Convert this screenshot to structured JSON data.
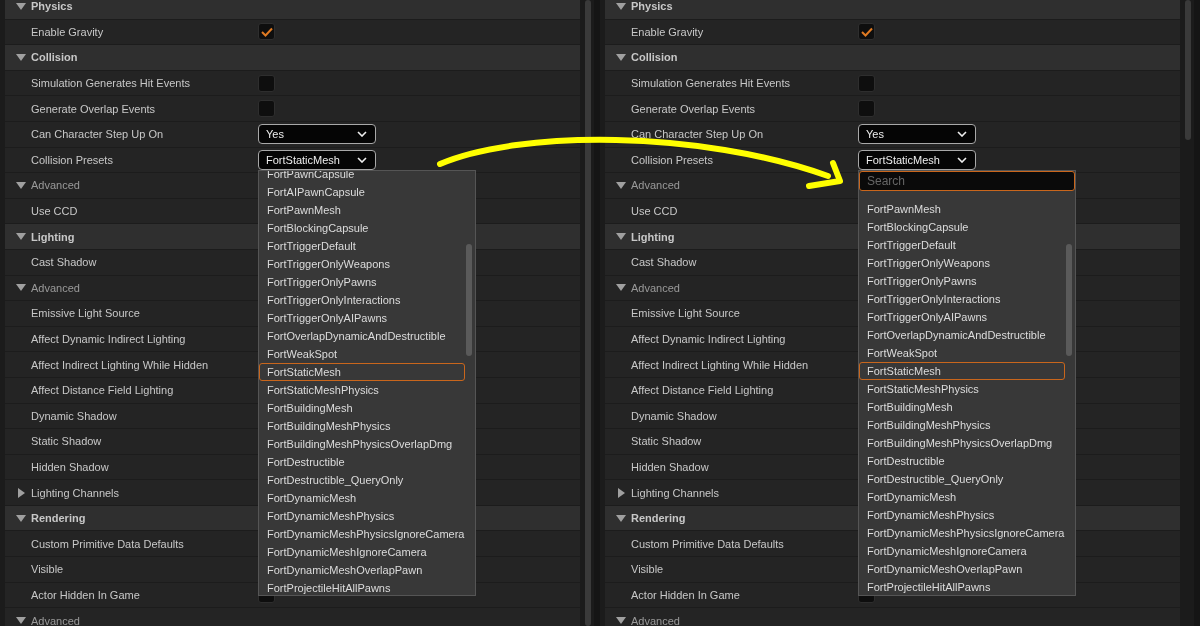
{
  "panels": [
    {
      "rows": [
        {
          "kind": "section",
          "label": "Physics",
          "expanded": true
        },
        {
          "kind": "checkbox",
          "label": "Enable Gravity",
          "checked": true
        },
        {
          "kind": "section",
          "label": "Collision",
          "expanded": true
        },
        {
          "kind": "checkbox",
          "label": "Simulation Generates Hit Events",
          "checked": false
        },
        {
          "kind": "checkbox",
          "label": "Generate Overlap Events",
          "checked": false
        },
        {
          "kind": "combo",
          "label": "Can Character Step Up On",
          "value": "Yes"
        },
        {
          "kind": "combo",
          "label": "Collision Presets",
          "value": "FortStaticMesh",
          "open": true
        },
        {
          "kind": "subsection",
          "label": "Advanced",
          "expanded": true
        },
        {
          "kind": "plain",
          "label": "Use CCD"
        },
        {
          "kind": "section",
          "label": "Lighting",
          "expanded": true
        },
        {
          "kind": "plain",
          "label": "Cast Shadow"
        },
        {
          "kind": "subsection",
          "label": "Advanced",
          "expanded": true
        },
        {
          "kind": "plain",
          "label": "Emissive Light Source"
        },
        {
          "kind": "plain",
          "label": "Affect Dynamic Indirect Lighting"
        },
        {
          "kind": "plain",
          "label": "Affect Indirect Lighting While Hidden"
        },
        {
          "kind": "plain",
          "label": "Affect Distance Field Lighting"
        },
        {
          "kind": "plain",
          "label": "Dynamic Shadow"
        },
        {
          "kind": "plain",
          "label": "Static Shadow"
        },
        {
          "kind": "plain",
          "label": "Hidden Shadow"
        },
        {
          "kind": "group",
          "label": "Lighting Channels",
          "expanded": false
        },
        {
          "kind": "section",
          "label": "Rendering",
          "expanded": true
        },
        {
          "kind": "plain",
          "label": "Custom Primitive Data Defaults"
        },
        {
          "kind": "plain",
          "label": "Visible"
        },
        {
          "kind": "checkbox",
          "label": "Actor Hidden In Game",
          "checked": false
        },
        {
          "kind": "subsection",
          "label": "Advanced",
          "expanded": true
        }
      ],
      "dropdown": {
        "items": [
          {
            "label": "FortPawnCapsule",
            "selected": false
          },
          {
            "label": "FortAIPawnCapsule",
            "selected": false
          },
          {
            "label": "FortPawnMesh",
            "selected": false
          },
          {
            "label": "FortBlockingCapsule",
            "selected": false
          },
          {
            "label": "FortTriggerDefault",
            "selected": false
          },
          {
            "label": "FortTriggerOnlyWeapons",
            "selected": false
          },
          {
            "label": "FortTriggerOnlyPawns",
            "selected": false
          },
          {
            "label": "FortTriggerOnlyInteractions",
            "selected": false
          },
          {
            "label": "FortTriggerOnlyAIPawns",
            "selected": false
          },
          {
            "label": "FortOverlapDynamicAndDestructible",
            "selected": false
          },
          {
            "label": "FortWeakSpot",
            "selected": false
          },
          {
            "label": "FortStaticMesh",
            "selected": true
          },
          {
            "label": "FortStaticMeshPhysics",
            "selected": false
          },
          {
            "label": "FortBuildingMesh",
            "selected": false
          },
          {
            "label": "FortBuildingMeshPhysics",
            "selected": false
          },
          {
            "label": "FortBuildingMeshPhysicsOverlapDmg",
            "selected": false
          },
          {
            "label": "FortDestructible",
            "selected": false
          },
          {
            "label": "FortDestructible_QueryOnly",
            "selected": false
          },
          {
            "label": "FortDynamicMesh",
            "selected": false
          },
          {
            "label": "FortDynamicMeshPhysics",
            "selected": false
          },
          {
            "label": "FortDynamicMeshPhysicsIgnoreCamera",
            "selected": false
          },
          {
            "label": "FortDynamicMeshIgnoreCamera",
            "selected": false
          },
          {
            "label": "FortDynamicMeshOverlapPawn",
            "selected": false
          },
          {
            "label": "FortProjectileHitAllPawns",
            "selected": false
          }
        ]
      }
    },
    {
      "rows": [
        {
          "kind": "section",
          "label": "Physics",
          "expanded": true
        },
        {
          "kind": "checkbox",
          "label": "Enable Gravity",
          "checked": true
        },
        {
          "kind": "section",
          "label": "Collision",
          "expanded": true
        },
        {
          "kind": "checkbox",
          "label": "Simulation Generates Hit Events",
          "checked": false
        },
        {
          "kind": "checkbox",
          "label": "Generate Overlap Events",
          "checked": false
        },
        {
          "kind": "combo",
          "label": "Can Character Step Up On",
          "value": "Yes"
        },
        {
          "kind": "combo",
          "label": "Collision Presets",
          "value": "FortStaticMesh",
          "open": true
        },
        {
          "kind": "subsection",
          "label": "Advanced",
          "expanded": true
        },
        {
          "kind": "plain",
          "label": "Use CCD"
        },
        {
          "kind": "section",
          "label": "Lighting",
          "expanded": true
        },
        {
          "kind": "plain",
          "label": "Cast Shadow"
        },
        {
          "kind": "subsection",
          "label": "Advanced",
          "expanded": true
        },
        {
          "kind": "plain",
          "label": "Emissive Light Source"
        },
        {
          "kind": "plain",
          "label": "Affect Dynamic Indirect Lighting"
        },
        {
          "kind": "plain",
          "label": "Affect Indirect Lighting While Hidden"
        },
        {
          "kind": "plain",
          "label": "Affect Distance Field Lighting"
        },
        {
          "kind": "plain",
          "label": "Dynamic Shadow"
        },
        {
          "kind": "plain",
          "label": "Static Shadow"
        },
        {
          "kind": "plain",
          "label": "Hidden Shadow"
        },
        {
          "kind": "group",
          "label": "Lighting Channels",
          "expanded": false
        },
        {
          "kind": "section",
          "label": "Rendering",
          "expanded": true
        },
        {
          "kind": "plain",
          "label": "Custom Primitive Data Defaults"
        },
        {
          "kind": "plain",
          "label": "Visible"
        },
        {
          "kind": "checkbox",
          "label": "Actor Hidden In Game",
          "checked": false
        },
        {
          "kind": "subsection",
          "label": "Advanced",
          "expanded": true
        }
      ],
      "dropdown": {
        "search": {
          "placeholder": "Search"
        },
        "items": [
          {
            "label": "FortPawnMesh",
            "selected": false
          },
          {
            "label": "FortBlockingCapsule",
            "selected": false
          },
          {
            "label": "FortTriggerDefault",
            "selected": false
          },
          {
            "label": "FortTriggerOnlyWeapons",
            "selected": false
          },
          {
            "label": "FortTriggerOnlyPawns",
            "selected": false
          },
          {
            "label": "FortTriggerOnlyInteractions",
            "selected": false
          },
          {
            "label": "FortTriggerOnlyAIPawns",
            "selected": false
          },
          {
            "label": "FortOverlapDynamicAndDestructible",
            "selected": false
          },
          {
            "label": "FortWeakSpot",
            "selected": false
          },
          {
            "label": "FortStaticMesh",
            "selected": true
          },
          {
            "label": "FortStaticMeshPhysics",
            "selected": false
          },
          {
            "label": "FortBuildingMesh",
            "selected": false
          },
          {
            "label": "FortBuildingMeshPhysics",
            "selected": false
          },
          {
            "label": "FortBuildingMeshPhysicsOverlapDmg",
            "selected": false
          },
          {
            "label": "FortDestructible",
            "selected": false
          },
          {
            "label": "FortDestructible_QueryOnly",
            "selected": false
          },
          {
            "label": "FortDynamicMesh",
            "selected": false
          },
          {
            "label": "FortDynamicMeshPhysics",
            "selected": false
          },
          {
            "label": "FortDynamicMeshPhysicsIgnoreCamera",
            "selected": false
          },
          {
            "label": "FortDynamicMeshIgnoreCamera",
            "selected": false
          },
          {
            "label": "FortDynamicMeshOverlapPawn",
            "selected": false
          },
          {
            "label": "FortProjectileHitAllPawns",
            "selected": false
          }
        ]
      }
    }
  ]
}
